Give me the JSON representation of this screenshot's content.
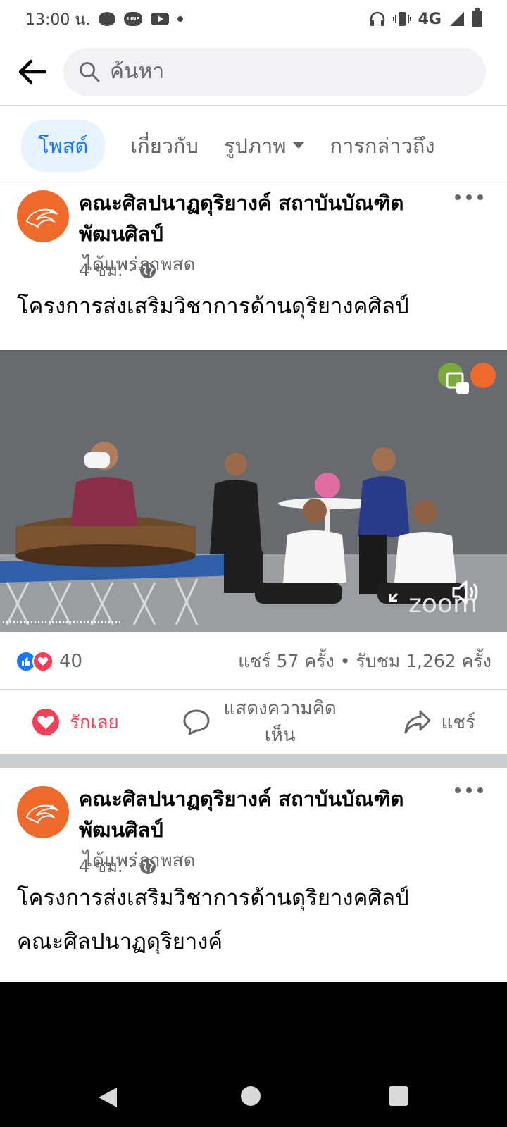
{
  "status_bar": {
    "time": "13:00 น.",
    "network": "4G"
  },
  "search": {
    "placeholder": "ค้นหา"
  },
  "tabs": [
    {
      "label": "โพสต์",
      "active": true
    },
    {
      "label": "เกี่ยวกับ"
    },
    {
      "label": "รูปภาพ"
    },
    {
      "label": "การกล่าวถึง"
    }
  ],
  "posts": [
    {
      "author": "คณะศิลปนาฏดุริยางค์ สถาบันบัณฑิตพัฒนศิลป์",
      "action": "ได้แพร่ภาพสด",
      "time": "4 ชม. ·",
      "text": [
        "โครงการส่งเสริมวิชาการด้านดุริยางคศิลป์"
      ],
      "reactions_count": "40",
      "stats": "แชร์ 57 ครั้ง • รับชม 1,262 ครั้ง",
      "actions": {
        "love": "รักเลย",
        "comment": "แสดงความคิดเห็น",
        "share": "แชร์"
      }
    },
    {
      "author": "คณะศิลปนาฏดุริยางค์ สถาบันบัณฑิตพัฒนศิลป์",
      "action": "ได้แพร่ภาพสด",
      "time": "4 ชม. ·",
      "text": [
        "โครงการส่งเสริมวิชาการด้านดุริยางคศิลป์",
        "คณะศิลปนาฏดุริยางค์"
      ]
    }
  ],
  "video_overlay": {
    "watermark": "zoom"
  },
  "colors": {
    "accent": "#1877f2",
    "love": "#f33e58",
    "avatar": "#ee6a2c"
  }
}
